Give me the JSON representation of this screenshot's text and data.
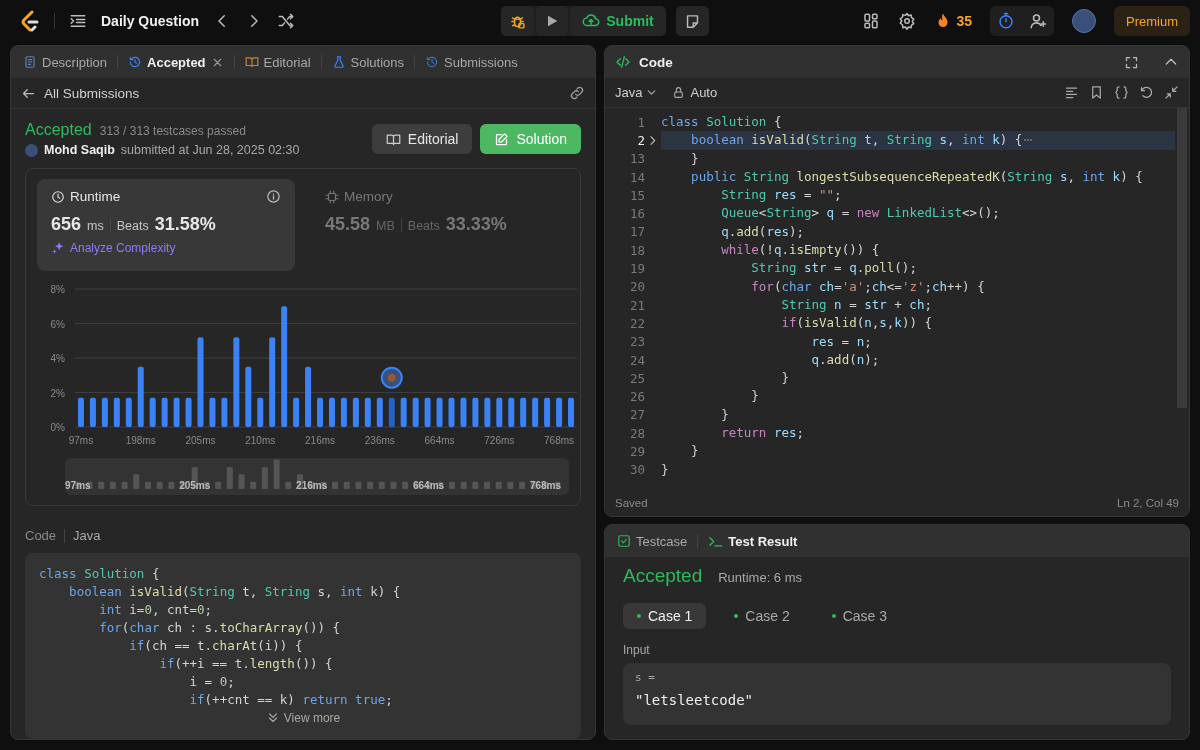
{
  "topbar": {
    "title": "Daily Question",
    "submit": "Submit",
    "streak": "35",
    "premium": "Premium"
  },
  "left_tabs": [
    {
      "label": "Description",
      "selected": false,
      "closable": false
    },
    {
      "label": "Accepted",
      "selected": true,
      "closable": true
    },
    {
      "label": "Editorial",
      "selected": false,
      "closable": false
    },
    {
      "label": "Solutions",
      "selected": false,
      "closable": false
    },
    {
      "label": "Submissions",
      "selected": false,
      "closable": false
    }
  ],
  "back_link": "All Submissions",
  "submission": {
    "status": "Accepted",
    "testcases": "313 / 313 testcases passed",
    "user": "Mohd Saqib",
    "submitted": "submitted at Jun 28, 2025 02:30",
    "buttons": [
      "Editorial",
      "Solution"
    ]
  },
  "stats": [
    {
      "title": "Runtime",
      "value": "656",
      "unit": "ms",
      "beats_label": "Beats",
      "beats": "31.58%",
      "selected": true,
      "link": "Analyze Complexity"
    },
    {
      "title": "Memory",
      "value": "45.58",
      "unit": "MB",
      "beats_label": "Beats",
      "beats": "33.33%",
      "selected": false
    }
  ],
  "chart_data": {
    "type": "bar",
    "categories": [
      "97ms",
      null,
      null,
      null,
      null,
      "198ms",
      null,
      null,
      null,
      null,
      "205ms",
      null,
      null,
      null,
      null,
      "210ms",
      null,
      null,
      null,
      null,
      "216ms",
      null,
      null,
      null,
      null,
      "236ms",
      null,
      null,
      null,
      null,
      "664ms",
      null,
      null,
      null,
      null,
      "726ms",
      null,
      null,
      null,
      null,
      "768ms",
      null
    ],
    "values": [
      1.7,
      1.7,
      1.7,
      1.7,
      1.7,
      3.5,
      1.7,
      1.7,
      1.7,
      1.7,
      5.2,
      1.7,
      1.7,
      5.2,
      3.5,
      1.7,
      5.2,
      7.0,
      1.7,
      3.5,
      1.7,
      1.7,
      1.7,
      1.7,
      1.7,
      1.7,
      1.7,
      1.7,
      1.7,
      1.7,
      1.7,
      1.7,
      1.7,
      1.7,
      1.7,
      1.7,
      1.7,
      1.7,
      1.7,
      1.7,
      1.7,
      1.7
    ],
    "ylim": [
      0,
      8
    ],
    "yticks": [
      {
        "value": 0,
        "label": "0%"
      },
      {
        "value": 2,
        "label": "2%"
      },
      {
        "value": 4,
        "label": "4%"
      },
      {
        "value": 6,
        "label": "6%"
      },
      {
        "value": 8,
        "label": "8%"
      }
    ],
    "grid": true
  },
  "submission_marker": {
    "level": 0.631
  },
  "overview": {
    "labels": [
      "97ms",
      "205ms",
      "216ms",
      "664ms",
      "768ms"
    ]
  },
  "code_preview": {
    "label": "Code",
    "language": "Java",
    "more": "View more",
    "lines": [
      [
        {
          "kind": "kw",
          "text": "class "
        },
        {
          "kind": "type",
          "text": "Solution"
        },
        {
          "kind": "p",
          "text": " {"
        }
      ],
      [
        {
          "kind": "kw",
          "text": "    boolean "
        },
        {
          "kind": "fn",
          "text": "isValid"
        },
        {
          "kind": "p",
          "text": "("
        },
        {
          "kind": "type",
          "text": "String "
        },
        {
          "kind": "p",
          "text": "t, "
        },
        {
          "kind": "type",
          "text": "String "
        },
        {
          "kind": "p",
          "text": "s, "
        },
        {
          "kind": "kw",
          "text": "int "
        },
        {
          "kind": "p",
          "text": "k) {"
        }
      ],
      [
        {
          "kind": "kw",
          "text": "        int "
        },
        {
          "kind": "p",
          "text": "i="
        },
        {
          "kind": "num",
          "text": "0"
        },
        {
          "kind": "p",
          "text": ", cnt="
        },
        {
          "kind": "num",
          "text": "0"
        },
        {
          "kind": "p",
          "text": ";"
        }
      ],
      [
        {
          "kind": "kw",
          "text": "        for"
        },
        {
          "kind": "p",
          "text": "("
        },
        {
          "kind": "kw",
          "text": "char "
        },
        {
          "kind": "p",
          "text": "ch : s."
        },
        {
          "kind": "fn",
          "text": "toCharArray"
        },
        {
          "kind": "p",
          "text": "()) {"
        }
      ],
      [
        {
          "kind": "kw",
          "text": "            if"
        },
        {
          "kind": "p",
          "text": "(ch == t."
        },
        {
          "kind": "fn",
          "text": "charAt"
        },
        {
          "kind": "p",
          "text": "(i)) {"
        }
      ],
      [
        {
          "kind": "kw",
          "text": "                if"
        },
        {
          "kind": "p",
          "text": "(++i == t."
        },
        {
          "kind": "fn",
          "text": "length"
        },
        {
          "kind": "p",
          "text": "()) {"
        }
      ],
      [
        {
          "kind": "p",
          "text": "                    i = "
        },
        {
          "kind": "num",
          "text": "0"
        },
        {
          "kind": "p",
          "text": ";"
        }
      ],
      [
        {
          "kind": "kw",
          "text": "                    if"
        },
        {
          "kind": "p",
          "text": "(++cnt == k) "
        },
        {
          "kind": "kw",
          "text": "return true"
        },
        {
          "kind": "p",
          "text": ";"
        }
      ]
    ]
  },
  "editor": {
    "title": "Code",
    "language": "Java",
    "mode": "Auto",
    "status": "Saved",
    "cursor": "Ln 2, Col 49",
    "lines": [
      {
        "n": "1",
        "fold": false,
        "current": false,
        "tokens": [
          {
            "kind": "kw",
            "text": "class "
          },
          {
            "kind": "type",
            "text": "Solution"
          },
          {
            "kind": "p",
            "text": " {"
          }
        ]
      },
      {
        "n": "2",
        "fold": true,
        "current": true,
        "tokens": [
          {
            "kind": "kw",
            "text": "    boolean "
          },
          {
            "kind": "fn",
            "text": "isValid"
          },
          {
            "kind": "p",
            "text": "("
          },
          {
            "kind": "type",
            "text": "String "
          },
          {
            "kind": "var",
            "text": "t"
          },
          {
            "kind": "p",
            "text": ", "
          },
          {
            "kind": "type",
            "text": "String "
          },
          {
            "kind": "var",
            "text": "s"
          },
          {
            "kind": "p",
            "text": ", "
          },
          {
            "kind": "kw",
            "text": "int "
          },
          {
            "kind": "var",
            "text": "k"
          },
          {
            "kind": "p",
            "text": ") {"
          }
        ]
      },
      {
        "n": "13",
        "fold": false,
        "current": false,
        "tokens": [
          {
            "kind": "p",
            "text": "    }"
          }
        ]
      },
      {
        "n": "14",
        "fold": false,
        "current": false,
        "tokens": [
          {
            "kind": "kw",
            "text": "    public "
          },
          {
            "kind": "type",
            "text": "String "
          },
          {
            "kind": "fn",
            "text": "longestSubsequenceRepeatedK"
          },
          {
            "kind": "p",
            "text": "("
          },
          {
            "kind": "type",
            "text": "String "
          },
          {
            "kind": "var",
            "text": "s"
          },
          {
            "kind": "p",
            "text": ", "
          },
          {
            "kind": "kw",
            "text": "int "
          },
          {
            "kind": "var",
            "text": "k"
          },
          {
            "kind": "p",
            "text": ") {"
          }
        ]
      },
      {
        "n": "15",
        "fold": false,
        "current": false,
        "tokens": [
          {
            "kind": "type",
            "text": "        String "
          },
          {
            "kind": "var",
            "text": "res"
          },
          {
            "kind": "p",
            "text": " = "
          },
          {
            "kind": "str",
            "text": "\"\""
          },
          {
            "kind": "p",
            "text": ";"
          }
        ]
      },
      {
        "n": "16",
        "fold": false,
        "current": false,
        "tokens": [
          {
            "kind": "type",
            "text": "        Queue"
          },
          {
            "kind": "p",
            "text": "<"
          },
          {
            "kind": "type",
            "text": "String"
          },
          {
            "kind": "p",
            "text": "> "
          },
          {
            "kind": "var",
            "text": "q"
          },
          {
            "kind": "p",
            "text": " = "
          },
          {
            "kind": "ctrl",
            "text": "new "
          },
          {
            "kind": "type",
            "text": "LinkedList"
          },
          {
            "kind": "p",
            "text": "<>();"
          }
        ]
      },
      {
        "n": "17",
        "fold": false,
        "current": false,
        "tokens": [
          {
            "kind": "var",
            "text": "        q"
          },
          {
            "kind": "p",
            "text": "."
          },
          {
            "kind": "fn",
            "text": "add"
          },
          {
            "kind": "p",
            "text": "("
          },
          {
            "kind": "var",
            "text": "res"
          },
          {
            "kind": "p",
            "text": ");"
          }
        ]
      },
      {
        "n": "18",
        "fold": false,
        "current": false,
        "tokens": [
          {
            "kind": "ctrl",
            "text": "        while"
          },
          {
            "kind": "p",
            "text": "(!"
          },
          {
            "kind": "var",
            "text": "q"
          },
          {
            "kind": "p",
            "text": "."
          },
          {
            "kind": "fn",
            "text": "isEmpty"
          },
          {
            "kind": "p",
            "text": "()) {"
          }
        ]
      },
      {
        "n": "19",
        "fold": false,
        "current": false,
        "tokens": [
          {
            "kind": "type",
            "text": "            String "
          },
          {
            "kind": "var",
            "text": "str"
          },
          {
            "kind": "p",
            "text": " = "
          },
          {
            "kind": "var",
            "text": "q"
          },
          {
            "kind": "p",
            "text": "."
          },
          {
            "kind": "fn",
            "text": "poll"
          },
          {
            "kind": "p",
            "text": "();"
          }
        ]
      },
      {
        "n": "20",
        "fold": false,
        "current": false,
        "tokens": [
          {
            "kind": "ctrl",
            "text": "            for"
          },
          {
            "kind": "p",
            "text": "("
          },
          {
            "kind": "kw",
            "text": "char "
          },
          {
            "kind": "var",
            "text": "ch"
          },
          {
            "kind": "p",
            "text": "="
          },
          {
            "kind": "str",
            "text": "'a'"
          },
          {
            "kind": "p",
            "text": ";"
          },
          {
            "kind": "var",
            "text": "ch"
          },
          {
            "kind": "p",
            "text": "<="
          },
          {
            "kind": "str",
            "text": "'z'"
          },
          {
            "kind": "p",
            "text": ";"
          },
          {
            "kind": "var",
            "text": "ch"
          },
          {
            "kind": "p",
            "text": "++) {"
          }
        ]
      },
      {
        "n": "21",
        "fold": false,
        "current": false,
        "tokens": [
          {
            "kind": "type",
            "text": "                String "
          },
          {
            "kind": "var",
            "text": "n"
          },
          {
            "kind": "p",
            "text": " = "
          },
          {
            "kind": "var",
            "text": "str"
          },
          {
            "kind": "p",
            "text": " + "
          },
          {
            "kind": "var",
            "text": "ch"
          },
          {
            "kind": "p",
            "text": ";"
          }
        ]
      },
      {
        "n": "22",
        "fold": false,
        "current": false,
        "tokens": [
          {
            "kind": "ctrl",
            "text": "                if"
          },
          {
            "kind": "p",
            "text": "("
          },
          {
            "kind": "fn",
            "text": "isValid"
          },
          {
            "kind": "p",
            "text": "("
          },
          {
            "kind": "var",
            "text": "n"
          },
          {
            "kind": "p",
            "text": ","
          },
          {
            "kind": "var",
            "text": "s"
          },
          {
            "kind": "p",
            "text": ","
          },
          {
            "kind": "var",
            "text": "k"
          },
          {
            "kind": "p",
            "text": ")) {"
          }
        ]
      },
      {
        "n": "23",
        "fold": false,
        "current": false,
        "tokens": [
          {
            "kind": "var",
            "text": "                    res"
          },
          {
            "kind": "p",
            "text": " = "
          },
          {
            "kind": "var",
            "text": "n"
          },
          {
            "kind": "p",
            "text": ";"
          }
        ]
      },
      {
        "n": "24",
        "fold": false,
        "current": false,
        "tokens": [
          {
            "kind": "var",
            "text": "                    q"
          },
          {
            "kind": "p",
            "text": "."
          },
          {
            "kind": "fn",
            "text": "add"
          },
          {
            "kind": "p",
            "text": "("
          },
          {
            "kind": "var",
            "text": "n"
          },
          {
            "kind": "p",
            "text": ");"
          }
        ]
      },
      {
        "n": "25",
        "fold": false,
        "current": false,
        "tokens": [
          {
            "kind": "p",
            "text": "                }"
          }
        ]
      },
      {
        "n": "26",
        "fold": false,
        "current": false,
        "tokens": [
          {
            "kind": "p",
            "text": "            }"
          }
        ]
      },
      {
        "n": "27",
        "fold": false,
        "current": false,
        "tokens": [
          {
            "kind": "p",
            "text": "        }"
          }
        ]
      },
      {
        "n": "28",
        "fold": false,
        "current": false,
        "tokens": [
          {
            "kind": "ctrl",
            "text": "        return "
          },
          {
            "kind": "var",
            "text": "res"
          },
          {
            "kind": "p",
            "text": ";"
          }
        ]
      },
      {
        "n": "29",
        "fold": false,
        "current": false,
        "tokens": [
          {
            "kind": "p",
            "text": "    }"
          }
        ]
      },
      {
        "n": "30",
        "fold": false,
        "current": false,
        "tokens": [
          {
            "kind": "p",
            "text": "}"
          }
        ]
      }
    ]
  },
  "result_tabs": [
    {
      "label": "Testcase",
      "selected": false
    },
    {
      "label": "Test Result",
      "selected": true
    }
  ],
  "result": {
    "status": "Accepted",
    "runtime": "Runtime: 6 ms",
    "cases": [
      {
        "label": "Case 1",
        "selected": true,
        "passed": true
      },
      {
        "label": "Case 2",
        "selected": false,
        "passed": true
      },
      {
        "label": "Case 3",
        "selected": false,
        "passed": true
      }
    ],
    "input_label": "Input",
    "var": "s =",
    "value": "\"letsleetcode\""
  }
}
